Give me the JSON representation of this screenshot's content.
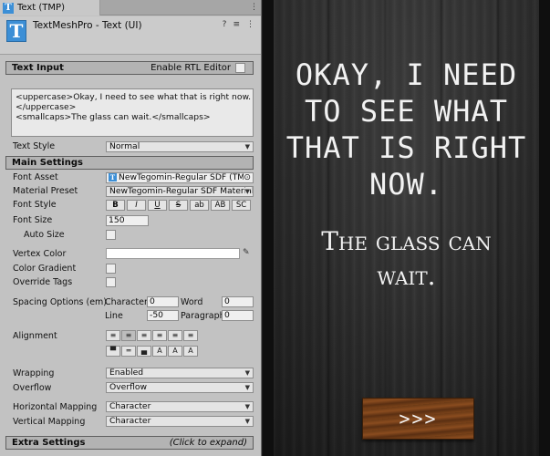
{
  "titlebar": {
    "tab_label": "Text (TMP)",
    "tab_icon": "T",
    "icons": [
      "⋮"
    ]
  },
  "component": {
    "icon": "T",
    "title": "TextMeshPro - Text (UI)",
    "header_icons": [
      "?",
      "≡",
      "⋮"
    ]
  },
  "text_input": {
    "section_label": "Text Input",
    "rtl_label": "Enable RTL Editor",
    "lines": [
      "<uppercase>Okay, I need to see what that is right now.",
      "</uppercase>",
      "",
      "<smallcaps>The glass can wait.</smallcaps>"
    ]
  },
  "text_style": {
    "label": "Text Style",
    "value": "Normal"
  },
  "main_settings": {
    "section_label": "Main Settings",
    "font_asset_label": "Font Asset",
    "font_asset_value": "NewTegomin-Regular SDF (TM",
    "material_preset_label": "Material Preset",
    "material_preset_value": "NewTegomin-Regular SDF Material",
    "font_style_label": "Font Style",
    "font_style_buttons": [
      "B",
      "I",
      "U",
      "S",
      "ab",
      "AB",
      "SC"
    ],
    "font_size_label": "Font Size",
    "font_size_value": "150",
    "auto_size_label": "Auto Size",
    "vertex_color_label": "Vertex Color",
    "color_gradient_label": "Color Gradient",
    "override_tags_label": "Override Tags",
    "spacing_label": "Spacing Options (em)",
    "character_label": "Character",
    "character_value": "0",
    "word_label": "Word",
    "word_value": "0",
    "line_label": "Line",
    "line_value": "-50",
    "paragraph_label": "Paragraph",
    "paragraph_value": "0",
    "alignment_label": "Alignment",
    "align_row1": [
      "≡",
      "≡",
      "≡",
      "≡",
      "≡",
      "≡"
    ],
    "align_row2": [
      "▀",
      "═",
      "▄",
      "A",
      "A",
      "A"
    ],
    "wrapping_label": "Wrapping",
    "wrapping_value": "Enabled",
    "overflow_label": "Overflow",
    "overflow_value": "Overflow",
    "hmap_label": "Horizontal Mapping",
    "hmap_value": "Character",
    "vmap_label": "Vertical Mapping",
    "vmap_value": "Character"
  },
  "extra_settings": {
    "section_label": "Extra Settings",
    "hint": "(Click to expand)"
  },
  "scene": {
    "upper_text": "Okay, I need to see what that is right now.",
    "smallcaps_text": "The glass can wait.",
    "button_label": ">>>"
  },
  "colors": {
    "accent": "#3c8fd6",
    "panel": "#c2c2c2",
    "wood": "#7a4219"
  }
}
